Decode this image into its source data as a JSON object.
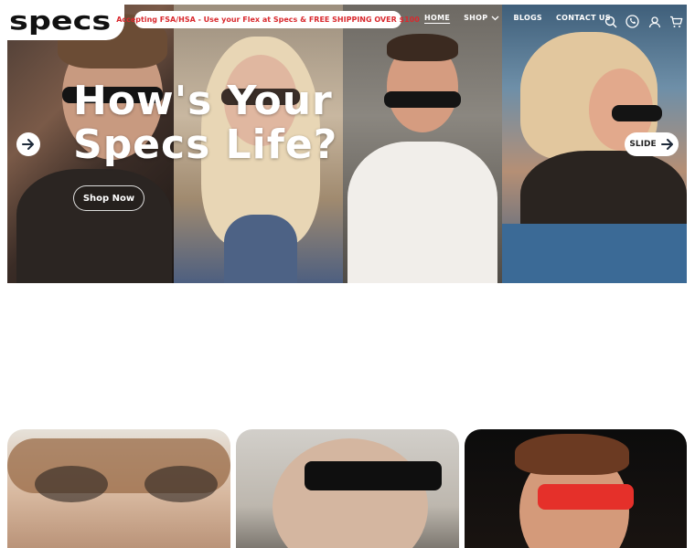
{
  "header": {
    "logo": "specs",
    "promo": "Accepting FSA/HSA - Use your Flex at Specs & FREE SHIPPING OVER $100",
    "nav": [
      {
        "label": "HOME",
        "active": true
      },
      {
        "label": "SHOP",
        "dropdown": true
      },
      {
        "label": "BLOGS"
      },
      {
        "label": "CONTACT US"
      }
    ],
    "icons": [
      "search-icon",
      "phone-icon",
      "account-icon",
      "cart-icon"
    ]
  },
  "hero": {
    "title": "How's Your\nSpecs Life?",
    "cta": "Shop Now",
    "slide_label": "SLIDE"
  },
  "colors": {
    "promo_text": "#d9292e",
    "nav_text": "#ffffff",
    "logo": "#111111"
  }
}
